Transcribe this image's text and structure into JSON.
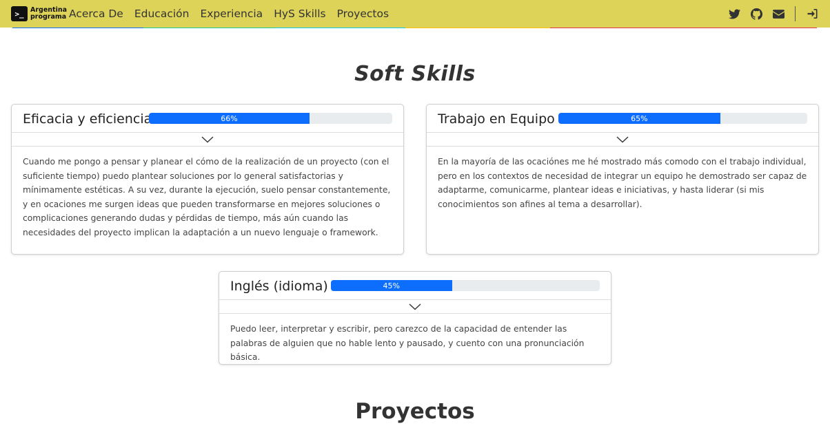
{
  "navbar": {
    "brand_line1": "Argentina",
    "brand_line2": "programa",
    "brand_symbol": ">_",
    "links": [
      "Acerca De",
      "Educación",
      "Experiencia",
      "HyS Skills",
      "Proyectos"
    ],
    "icons": [
      "twitter-icon",
      "github-icon",
      "envelope-icon",
      "login-icon"
    ],
    "background": "#ddd359"
  },
  "soft_skills": {
    "title": "Soft Skills",
    "items": [
      {
        "name": "Eficacia y eficiencia",
        "percent_label": "66%",
        "percent": 66,
        "description": "Cuando me pongo a pensar y planear el cómo de la realización de un proyecto (con el suficiente tiempo) puedo plantear soluciones por lo general satisfactorias y mínimamente estéticas. A su vez, durante la ejecución, suelo pensar constantemente, y en ocaciones me surgen ideas que pueden transformarse en mejores soluciones o complicaciones generando dudas y pérdidas de tiempo, más aún cuando las necesidades del proyecto implican la adaptación a un nuevo lenguaje o framework."
      },
      {
        "name": "Trabajo en Equipo",
        "percent_label": "65%",
        "percent": 65,
        "description": "En la mayoría de las ocaciónes me hé mostrado más comodo con el trabajo individual, pero en los contextos de necesidad de integrar un equipo he demostrado ser capaz de adaptarme, comunicarme, plantear ideas e iniciativas, y hasta liderar (si mis conocimientos son afines al tema a desarrollar)."
      },
      {
        "name": "Inglés (idioma)",
        "percent_label": "45%",
        "percent": 45,
        "description": "Puedo leer, interpretar y escribir, pero carezco de la capacidad de entender las palabras de alguien que no hable lento y pausado, y cuento con una pronunciación básica."
      }
    ],
    "accent_color": "#0d6efd"
  },
  "projects": {
    "title": "Proyectos"
  }
}
